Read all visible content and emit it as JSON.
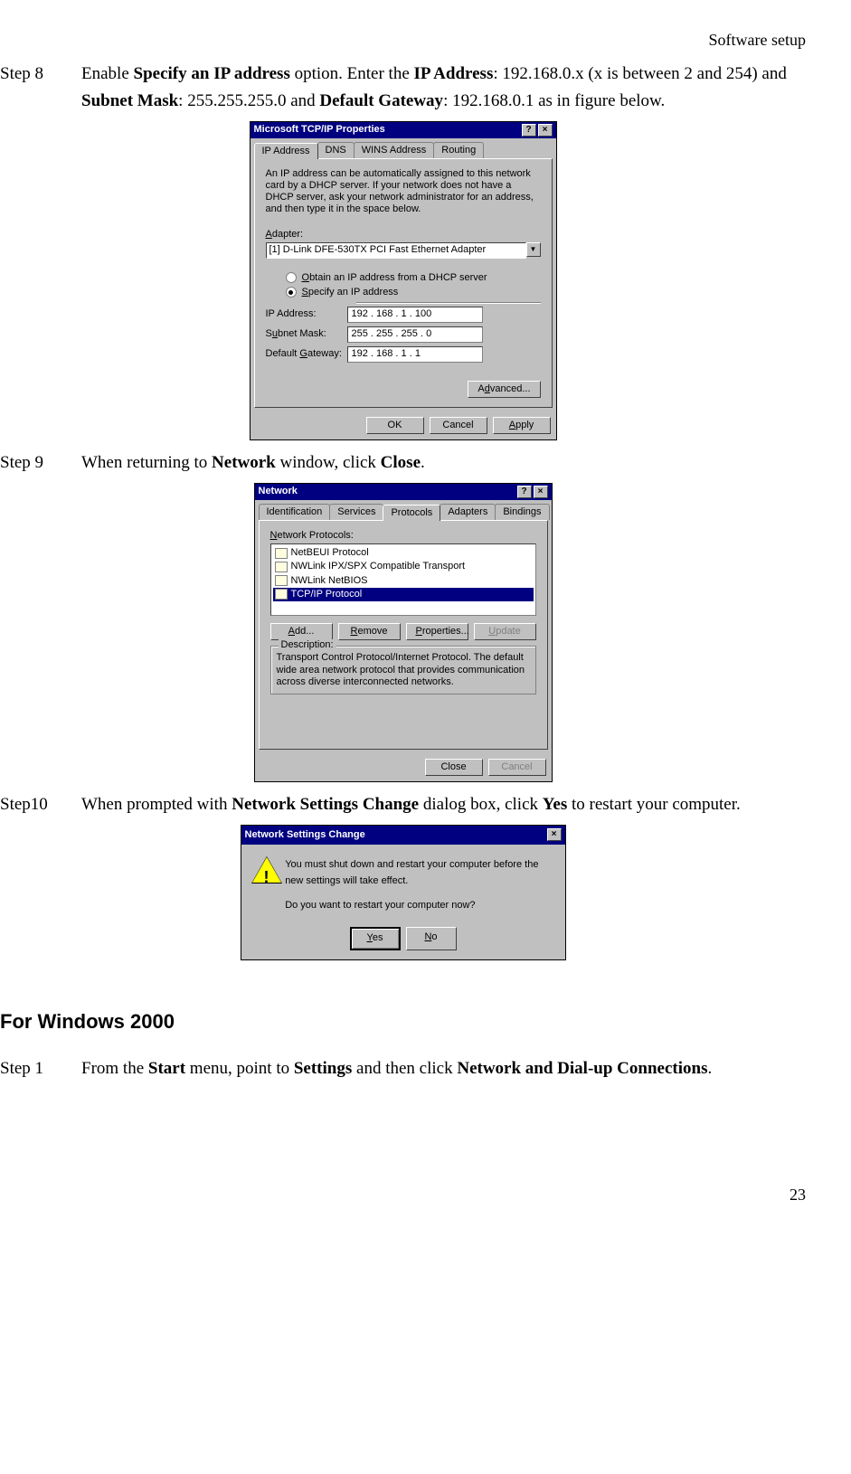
{
  "header": "Software  setup",
  "step8": {
    "label": "Step 8",
    "t1": "Enable ",
    "b1": "Specify an IP address",
    "t2": " option. Enter the ",
    "b2": "IP Address",
    "t3": ": 192.168.0.x (x is between 2 and 254) and ",
    "b3": "Subnet Mask",
    "t4": ": 255.255.255.0 and ",
    "b4": "Default Gateway",
    "t5": ": 192.168.0.1 as in figure below."
  },
  "tcpip": {
    "title": "Microsoft TCP/IP Properties",
    "tabs": [
      "IP Address",
      "DNS",
      "WINS Address",
      "Routing"
    ],
    "info": "An IP address can be automatically assigned to this network card by a DHCP server. If your network does not have a DHCP server, ask your network administrator for an address, and then type it in the space below.",
    "adapter_label": "Adapter:",
    "adapter_value": "[1] D-Link DFE-530TX PCI Fast Ethernet Adapter",
    "r1": "Obtain an IP address from a DHCP server",
    "r2": "Specify an IP address",
    "ip_label": "IP Address:",
    "ip_value": "192 . 168 .  1   . 100",
    "sn_label": "Subnet Mask:",
    "sn_value": "255 . 255 . 255 .  0",
    "gw_label": "Default Gateway:",
    "gw_value": "192 . 168 .  1   .  1",
    "adv": "Advanced...",
    "ok": "OK",
    "cancel": "Cancel",
    "apply": "Apply"
  },
  "step9": {
    "label": "Step 9",
    "t1": "When returning to ",
    "b1": "Network",
    "t2": " window, click ",
    "b2": "Close",
    "t3": "."
  },
  "network": {
    "title": "Network",
    "tabs": [
      "Identification",
      "Services",
      "Protocols",
      "Adapters",
      "Bindings"
    ],
    "list_label": "Network Protocols:",
    "items": [
      "NetBEUI Protocol",
      "NWLink IPX/SPX Compatible Transport",
      "NWLink NetBIOS",
      "TCP/IP Protocol"
    ],
    "add": "Add...",
    "remove": "Remove",
    "props": "Properties...",
    "update": "Update",
    "desc_label": "Description:",
    "desc": "Transport Control Protocol/Internet Protocol. The default wide area network protocol that provides communication across diverse interconnected networks.",
    "close": "Close",
    "cancel": "Cancel"
  },
  "step10": {
    "label": "Step10",
    "t1": "When prompted with ",
    "b1": "Network Settings Change",
    "t2": " dialog box, click ",
    "b2": "Yes",
    "t3": " to restart your computer."
  },
  "msg": {
    "title": "Network Settings Change",
    "line1": "You must shut down and restart your computer before the new settings will take effect.",
    "line2": "Do you want to restart your computer now?",
    "yes": "Yes",
    "no": "No"
  },
  "h2": "For Windows 2000",
  "step1": {
    "label": "Step 1",
    "t1": "From the ",
    "b1": "Start",
    "t2": " menu, point to ",
    "b2": "Settings",
    "t3": " and then click ",
    "b3": "Network and Dial-up Connections",
    "t4": "."
  },
  "pagenum": "23"
}
